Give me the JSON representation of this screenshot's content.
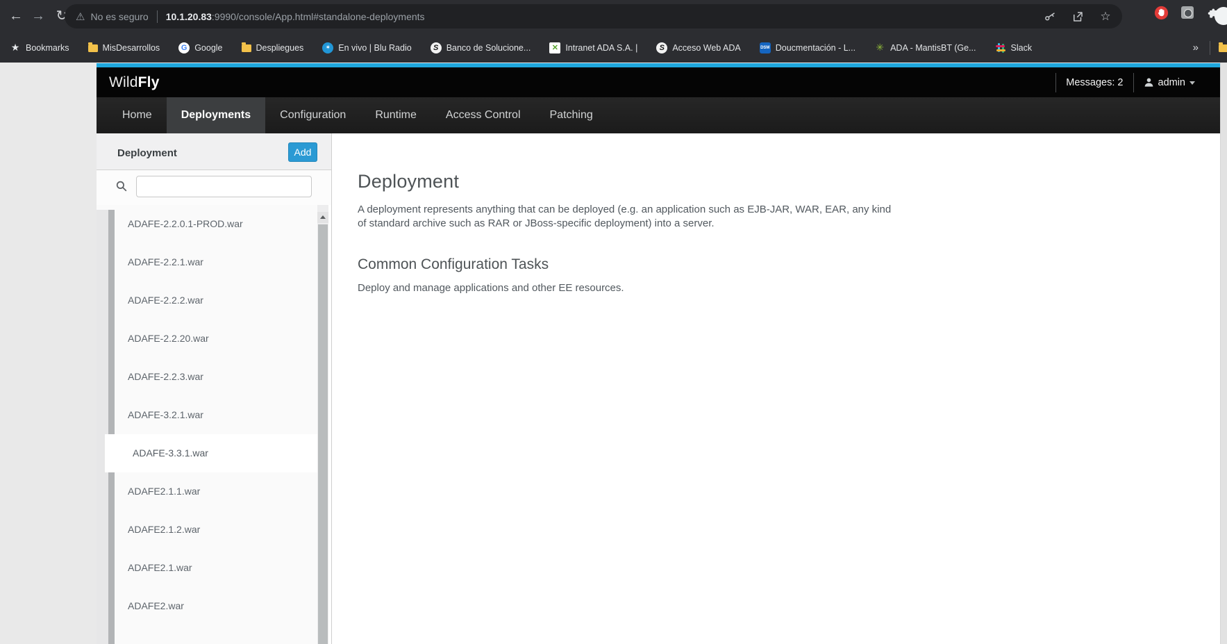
{
  "browser": {
    "back": "←",
    "forward": "→",
    "reload": "↻",
    "security_warning": "No es seguro",
    "url_host": "10.1.20.83",
    "url_rest": ":9990/console/App.html#standalone-deployments",
    "overflow_chevron": "»",
    "bookmarks": [
      {
        "label": "Bookmarks",
        "icon": "star",
        "name": "bookmark-bookmarks"
      },
      {
        "label": "MisDesarrollos",
        "icon": "folder",
        "name": "bookmark-misdesarrollos"
      },
      {
        "label": "Google",
        "icon": "google",
        "name": "bookmark-google"
      },
      {
        "label": "Despliegues",
        "icon": "folder",
        "name": "bookmark-despliegues"
      },
      {
        "label": "En vivo | Blu Radio",
        "icon": "bluradio",
        "name": "bookmark-blu-radio"
      },
      {
        "label": "Banco de Solucione...",
        "icon": "globe",
        "name": "bookmark-banco-de-soluciones"
      },
      {
        "label": "Intranet ADA S.A. |",
        "icon": "intranet",
        "name": "bookmark-intranet-ada"
      },
      {
        "label": "Acceso Web ADA",
        "icon": "globe",
        "name": "bookmark-acceso-web-ada"
      },
      {
        "label": "Doucmentación - L...",
        "icon": "dsm",
        "name": "bookmark-documentacion"
      },
      {
        "label": "ADA - MantisBT (Ge...",
        "icon": "mantis",
        "name": "bookmark-mantisbt"
      },
      {
        "label": "Slack",
        "icon": "slack",
        "name": "bookmark-slack"
      }
    ]
  },
  "header": {
    "logo_wild": "Wild",
    "logo_fly": "Fly",
    "messages_label": "Messages: 2",
    "user": "admin"
  },
  "nav": {
    "tabs": [
      {
        "label": "Home",
        "name": "tab-home"
      },
      {
        "label": "Deployments",
        "name": "tab-deployments",
        "active": true
      },
      {
        "label": "Configuration",
        "name": "tab-configuration"
      },
      {
        "label": "Runtime",
        "name": "tab-runtime"
      },
      {
        "label": "Access Control",
        "name": "tab-access-control"
      },
      {
        "label": "Patching",
        "name": "tab-patching"
      }
    ]
  },
  "sidebar": {
    "title": "Deployment",
    "add_label": "Add",
    "search_value": "",
    "items": [
      {
        "label": "ADAFE-2.2.0.1-PROD.war",
        "name": "deployment-item"
      },
      {
        "label": "ADAFE-2.2.1.war",
        "name": "deployment-item"
      },
      {
        "label": "ADAFE-2.2.2.war",
        "name": "deployment-item"
      },
      {
        "label": "ADAFE-2.2.20.war",
        "name": "deployment-item"
      },
      {
        "label": "ADAFE-2.2.3.war",
        "name": "deployment-item"
      },
      {
        "label": "ADAFE-3.2.1.war",
        "name": "deployment-item"
      },
      {
        "label": "ADAFE-3.3.1.war",
        "name": "deployment-item-selected",
        "selected": true
      },
      {
        "label": "ADAFE2.1.1.war",
        "name": "deployment-item"
      },
      {
        "label": "ADAFE2.1.2.war",
        "name": "deployment-item"
      },
      {
        "label": "ADAFE2.1.war",
        "name": "deployment-item"
      },
      {
        "label": "ADAFE2.war",
        "name": "deployment-item"
      }
    ]
  },
  "main": {
    "title": "Deployment",
    "description": "A deployment represents anything that can be deployed (e.g. an application such as EJB-JAR, WAR, EAR, any kind of standard archive such as RAR or JBoss-specific deployment) into a server.",
    "section_title": "Common Configuration Tasks",
    "section_description": "Deploy and manage applications and other EE resources."
  },
  "colors": {
    "accent_blue_line": "#1fa7dd",
    "add_button": "#2b9ad4",
    "chrome_dark": "#2c2d31",
    "url_pill": "#202124"
  }
}
